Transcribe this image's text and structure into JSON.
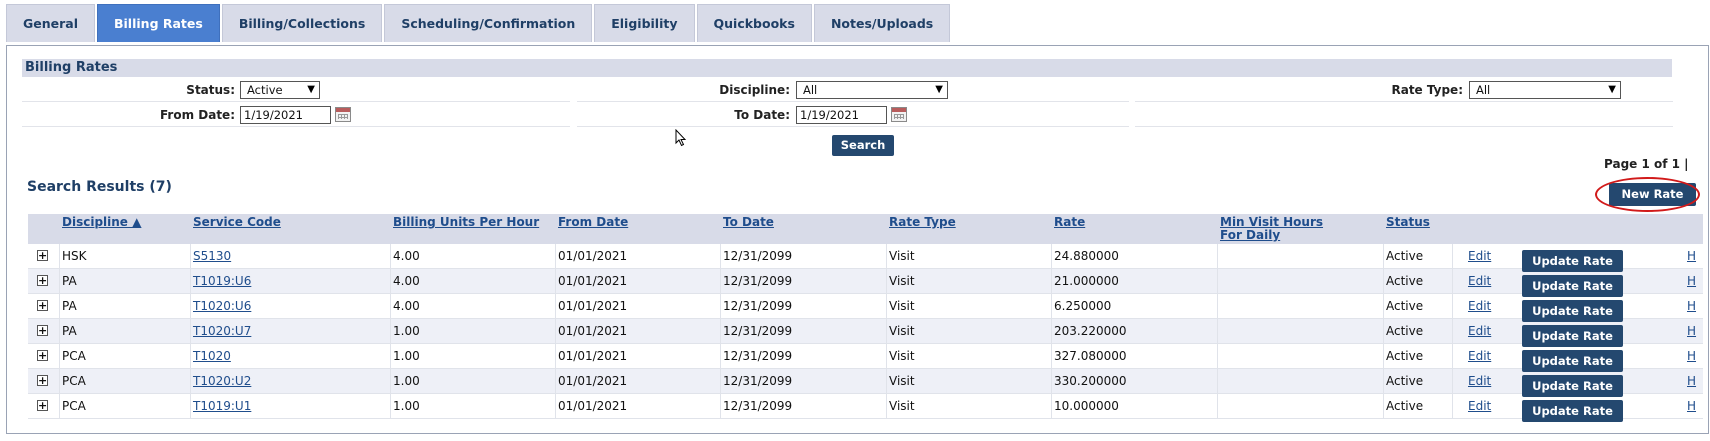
{
  "tabs": [
    {
      "label": "General",
      "active": false
    },
    {
      "label": "Billing Rates",
      "active": true
    },
    {
      "label": "Billing/Collections",
      "active": false
    },
    {
      "label": "Scheduling/Confirmation",
      "active": false
    },
    {
      "label": "Eligibility",
      "active": false
    },
    {
      "label": "Quickbooks",
      "active": false
    },
    {
      "label": "Notes/Uploads",
      "active": false
    }
  ],
  "section_title": "Billing Rates",
  "filters": {
    "status_label": "Status:",
    "status_value": "Active",
    "discipline_label": "Discipline:",
    "discipline_value": "All",
    "rate_type_label": "Rate Type:",
    "rate_type_value": "All",
    "from_date_label": "From Date:",
    "from_date_value": "1/19/2021",
    "to_date_label": "To Date:",
    "to_date_value": "1/19/2021",
    "search_button": "Search"
  },
  "page_info": "Page 1 of 1 |",
  "results_title": "Search Results (7)",
  "new_rate_button": "New Rate",
  "columns": {
    "discipline": "Discipline ▲",
    "service_code": "Service Code",
    "billing_units": "Billing Units Per Hour",
    "from_date": "From Date",
    "to_date": "To Date",
    "rate_type": "Rate Type",
    "rate": "Rate",
    "min_visit_line1": "Min Visit Hours",
    "min_visit_line2": "For Daily",
    "status": "Status"
  },
  "row_actions": {
    "edit": "Edit",
    "update": "Update Rate",
    "history": "H",
    "expand": "+"
  },
  "rows": [
    {
      "discipline": "HSK",
      "service_code": "S5130",
      "units": "4.00",
      "from": "01/01/2021",
      "to": "12/31/2099",
      "rate_type": "Visit",
      "rate": "24.880000",
      "min_visit": "",
      "status": "Active"
    },
    {
      "discipline": "PA",
      "service_code": "T1019:U6",
      "units": "4.00",
      "from": "01/01/2021",
      "to": "12/31/2099",
      "rate_type": "Visit",
      "rate": "21.000000",
      "min_visit": "",
      "status": "Active"
    },
    {
      "discipline": "PA",
      "service_code": "T1020:U6",
      "units": "4.00",
      "from": "01/01/2021",
      "to": "12/31/2099",
      "rate_type": "Visit",
      "rate": "6.250000",
      "min_visit": "",
      "status": "Active"
    },
    {
      "discipline": "PA",
      "service_code": "T1020:U7",
      "units": "1.00",
      "from": "01/01/2021",
      "to": "12/31/2099",
      "rate_type": "Visit",
      "rate": "203.220000",
      "min_visit": "",
      "status": "Active"
    },
    {
      "discipline": "PCA",
      "service_code": "T1020",
      "units": "1.00",
      "from": "01/01/2021",
      "to": "12/31/2099",
      "rate_type": "Visit",
      "rate": "327.080000",
      "min_visit": "",
      "status": "Active"
    },
    {
      "discipline": "PCA",
      "service_code": "T1020:U2",
      "units": "1.00",
      "from": "01/01/2021",
      "to": "12/31/2099",
      "rate_type": "Visit",
      "rate": "330.200000",
      "min_visit": "",
      "status": "Active"
    },
    {
      "discipline": "PCA",
      "service_code": "T1019:U1",
      "units": "1.00",
      "from": "01/01/2021",
      "to": "12/31/2099",
      "rate_type": "Visit",
      "rate": "10.000000",
      "min_visit": "",
      "status": "Active"
    }
  ]
}
